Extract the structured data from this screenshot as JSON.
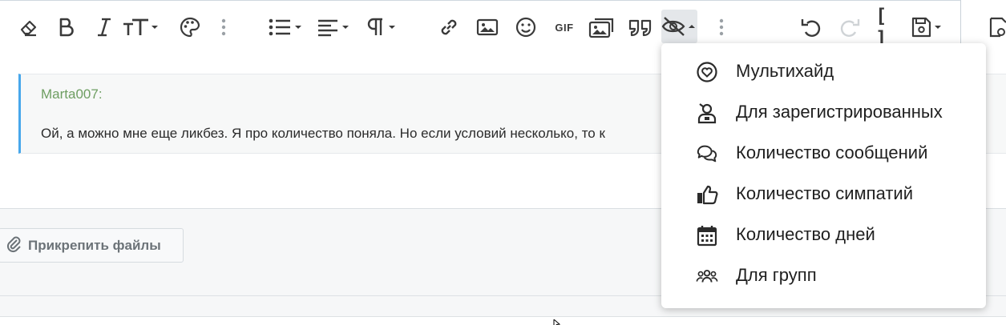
{
  "toolbar": {
    "buttons": [
      {
        "name": "eraser-icon"
      },
      {
        "name": "bold-icon"
      },
      {
        "name": "italic-icon"
      },
      {
        "name": "text-size-icon"
      },
      {
        "name": "palette-icon"
      },
      {
        "name": "more-vertical-icon"
      },
      {
        "name": "list-icon"
      },
      {
        "name": "align-icon"
      },
      {
        "name": "paragraph-icon"
      },
      {
        "name": "link-icon"
      },
      {
        "name": "image-icon"
      },
      {
        "name": "smiley-icon"
      },
      {
        "name": "gif-icon"
      },
      {
        "name": "media-icon"
      },
      {
        "name": "quote-icon"
      },
      {
        "name": "hide-icon"
      },
      {
        "name": "more-vertical-icon"
      },
      {
        "name": "undo-icon"
      },
      {
        "name": "redo-icon"
      },
      {
        "name": "brackets-icon"
      },
      {
        "name": "save-drafts-icon"
      },
      {
        "name": "preview-icon"
      }
    ],
    "gif_label": "GIF",
    "brackets_label": "[ ]"
  },
  "quote": {
    "author": "Marta007:",
    "text": "Ой, а можно мне еще ликбез. Я про количество поняла. Но если условий несколько, то к"
  },
  "attach": {
    "label": "Прикрепить файлы"
  },
  "hide_menu": {
    "items": [
      {
        "label": "Мультихайд",
        "icon": "heart-circle-icon"
      },
      {
        "label": "Для зарегистрированных",
        "icon": "user-badge-icon"
      },
      {
        "label": "Количество сообщений",
        "icon": "comments-icon"
      },
      {
        "label": "Количество симпатий",
        "icon": "thumbs-up-icon"
      },
      {
        "label": "Количество дней",
        "icon": "calendar-icon"
      },
      {
        "label": "Для групп",
        "icon": "users-icon"
      }
    ]
  },
  "colors": {
    "accent_border": "#47a7eb",
    "quote_author": "#6e9e62",
    "icon": "#3a3a3a"
  }
}
